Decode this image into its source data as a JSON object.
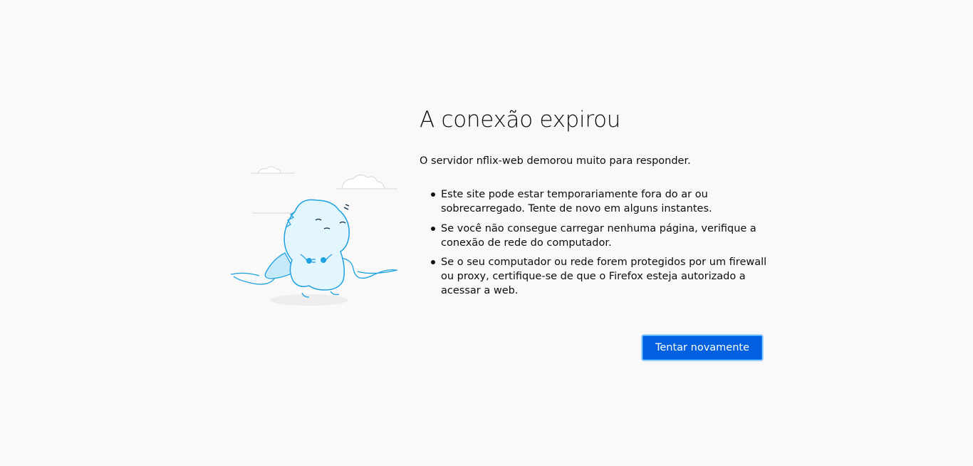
{
  "error_page": {
    "title": "A conexão expirou",
    "short_description": "O servidor nflix-web demorou muito para responder.",
    "advice": [
      "Este site pode estar temporariamente fora do ar ou sobrecarregado. Tente de novo em alguns instantes.",
      "Se você não consegue carregar nenhuma página, verifique a conexão de rede do computador.",
      "Se o seu computador ou rede forem protegidos por um firewall ou proxy, certifique-se de que o Firefox esteja autorizado a acessar a web."
    ],
    "try_again_label": "Tentar novamente",
    "illustration_icon": "unplugged-dino-icon"
  },
  "colors": {
    "background": "#f9f9fa",
    "accent": "#0060df",
    "illustration_stroke": "#1ea1e0",
    "illustration_fill": "#e3f5fd"
  }
}
